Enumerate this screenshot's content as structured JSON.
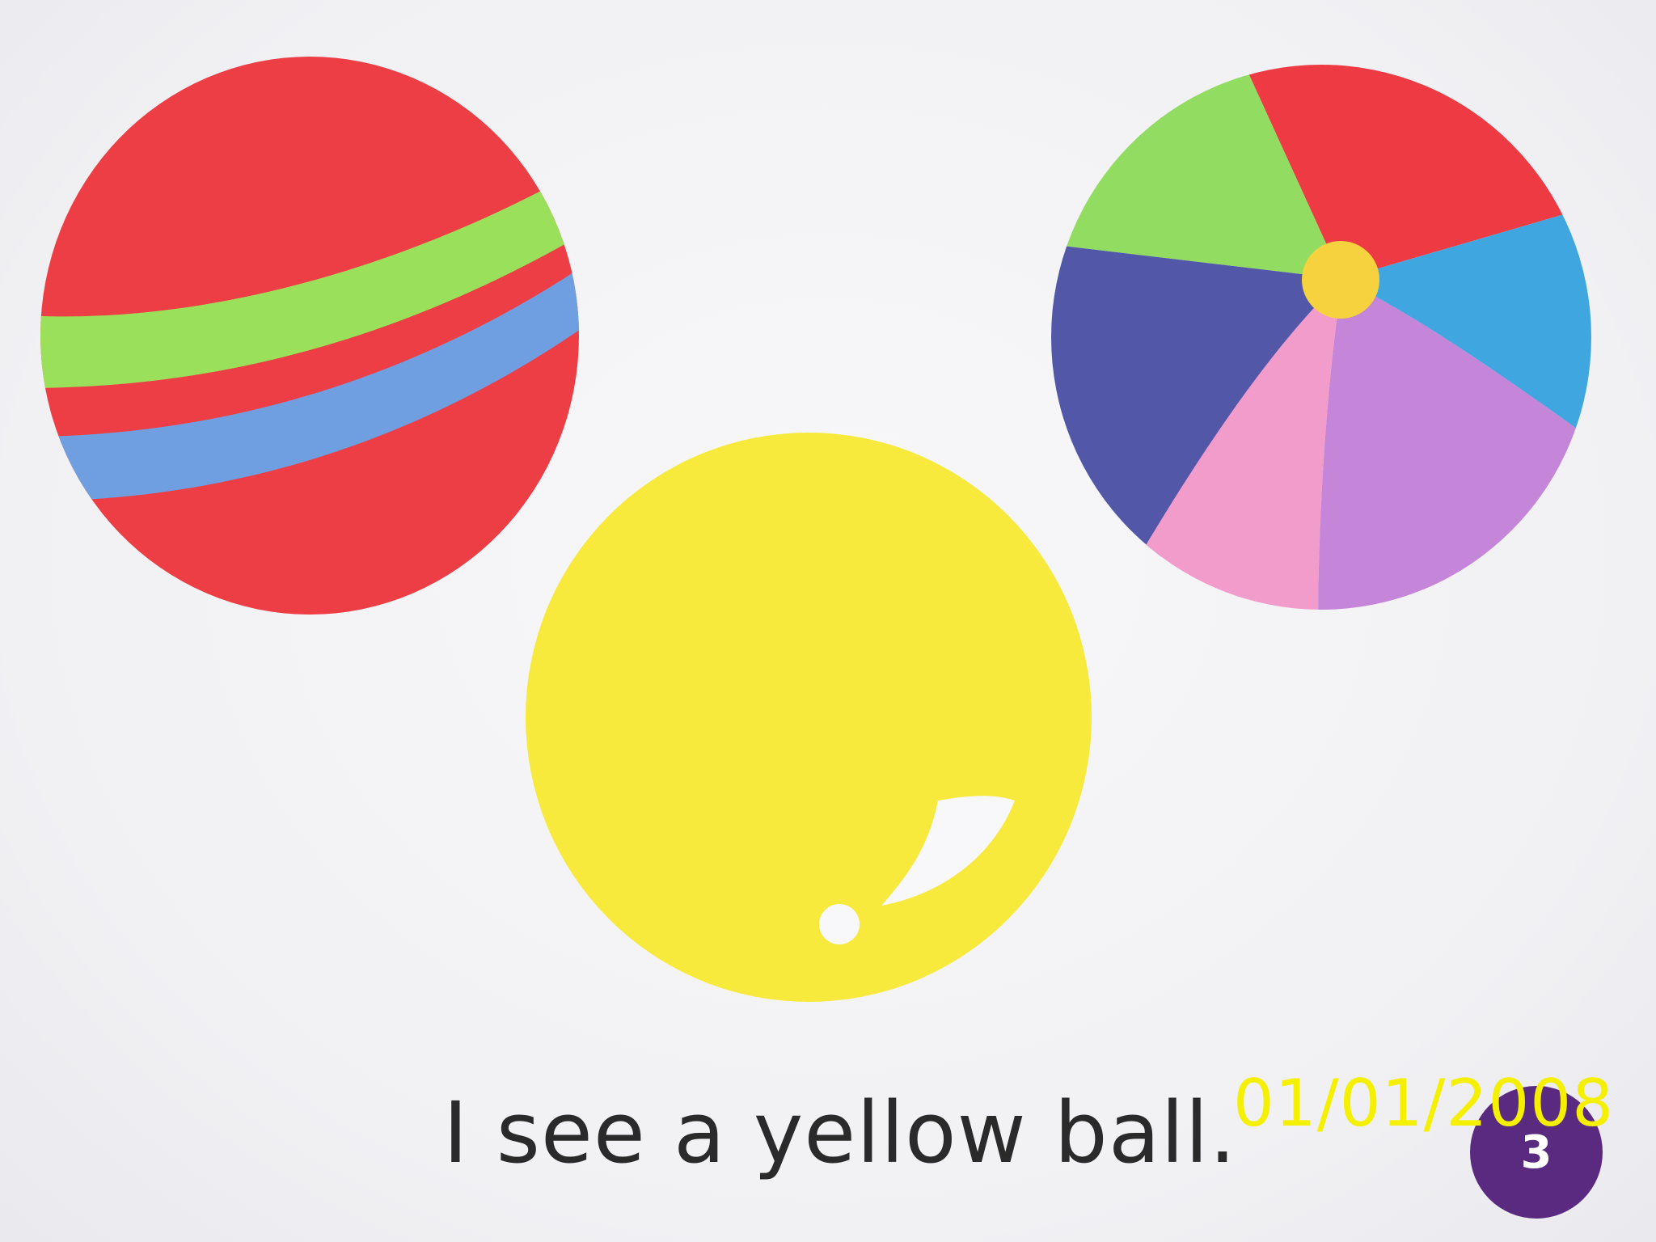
{
  "caption": "I see a yellow ball.",
  "date_stamp": "01/01/2008",
  "page_number": "3",
  "colors": {
    "background": "#f3f3f5",
    "red": "#ee3e45",
    "green": "#9be05a",
    "blue_stripe": "#6f9fe0",
    "yellow": "#f7ea3c",
    "beach_red": "#ee3a43",
    "beach_green": "#93dc62",
    "beach_blue": "#3fa6e0",
    "beach_indigo": "#5257a8",
    "beach_pink": "#f29ccb",
    "beach_purple": "#c585d9",
    "beach_center": "#f5d23e",
    "page_badge": "#5a2a80",
    "caption_text": "#2a2a2a",
    "date_text": "#f4f000"
  }
}
